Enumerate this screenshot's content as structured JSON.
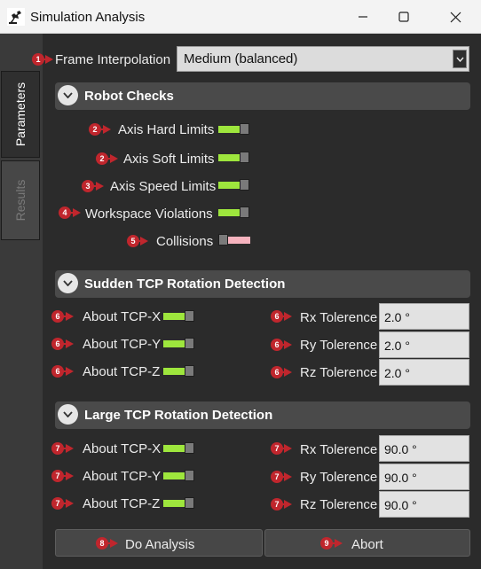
{
  "window": {
    "title": "Simulation Analysis"
  },
  "tabs": [
    {
      "label": "Parameters",
      "active": true
    },
    {
      "label": "Results",
      "active": false
    }
  ],
  "frame_interpolation": {
    "badge": "1",
    "label": "Frame Interpolation",
    "value": "Medium (balanced)"
  },
  "robot_checks": {
    "title": "Robot Checks",
    "items": [
      {
        "badge": "2",
        "label": "Axis Hard Limits",
        "state": "on"
      },
      {
        "badge": "2",
        "label": "Axis Soft Limits",
        "state": "on"
      },
      {
        "badge": "3",
        "label": "Axis Speed Limits",
        "state": "on"
      },
      {
        "badge": "4",
        "label": "Workspace Violations",
        "state": "on"
      },
      {
        "badge": "5",
        "label": "Collisions",
        "state": "off"
      }
    ]
  },
  "sudden_tcp": {
    "title": "Sudden TCP Rotation Detection",
    "axes": [
      {
        "badge": "6",
        "label": "About TCP-X",
        "state": "on"
      },
      {
        "badge": "6",
        "label": "About TCP-Y",
        "state": "on"
      },
      {
        "badge": "6",
        "label": "About TCP-Z",
        "state": "on"
      }
    ],
    "tolerances": [
      {
        "badge": "6",
        "label": "Rx Tolerence",
        "value": "2.0 °"
      },
      {
        "badge": "6",
        "label": "Ry Tolerence",
        "value": "2.0 °"
      },
      {
        "badge": "6",
        "label": "Rz Tolerence",
        "value": "2.0 °"
      }
    ]
  },
  "large_tcp": {
    "title": "Large TCP Rotation Detection",
    "axes": [
      {
        "badge": "7",
        "label": "About TCP-X",
        "state": "on"
      },
      {
        "badge": "7",
        "label": "About TCP-Y",
        "state": "on"
      },
      {
        "badge": "7",
        "label": "About TCP-Z",
        "state": "on"
      }
    ],
    "tolerances": [
      {
        "badge": "7",
        "label": "Rx Tolerence",
        "value": "90.0 °"
      },
      {
        "badge": "7",
        "label": "Ry Tolerence",
        "value": "90.0 °"
      },
      {
        "badge": "7",
        "label": "Rz Tolerence",
        "value": "90.0 °"
      }
    ]
  },
  "buttons": {
    "analysis": {
      "badge": "8",
      "label": "Do Analysis"
    },
    "abort": {
      "badge": "9",
      "label": "Abort"
    }
  },
  "colors": {
    "toggle_on": "#9ee63d",
    "toggle_off": "#f6b3be",
    "badge": "#c0262d",
    "background": "#2b2b2b"
  }
}
